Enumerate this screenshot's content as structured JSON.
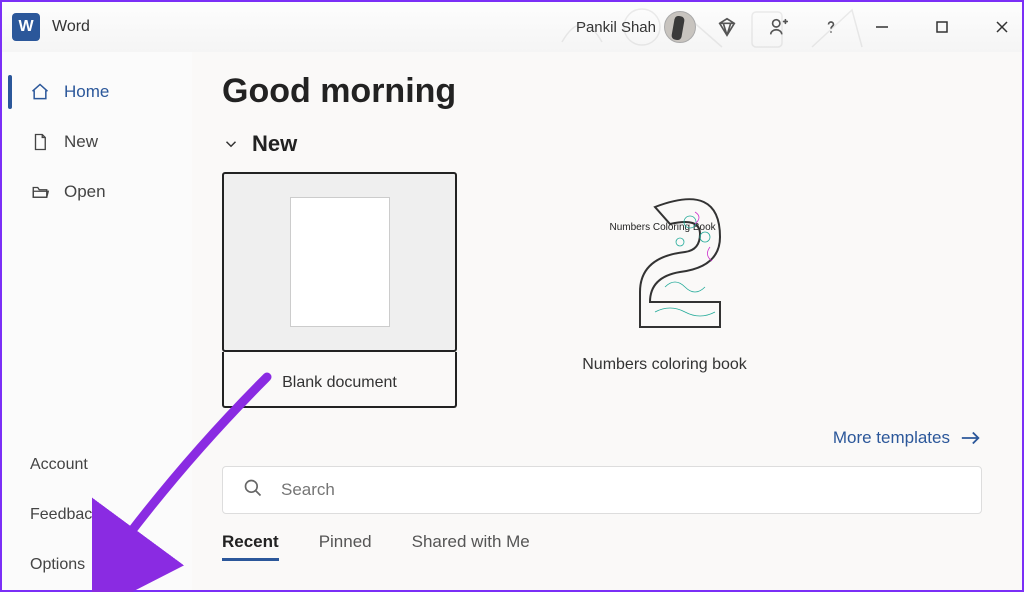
{
  "app": {
    "name": "Word",
    "logo_letter": "W"
  },
  "user": {
    "name": "Pankil Shah"
  },
  "sidebar": {
    "top": [
      {
        "label": "Home",
        "icon": "home"
      },
      {
        "label": "New",
        "icon": "file"
      },
      {
        "label": "Open",
        "icon": "folder"
      }
    ],
    "bottom": [
      {
        "label": "Account"
      },
      {
        "label": "Feedback"
      },
      {
        "label": "Options"
      }
    ]
  },
  "main": {
    "greeting": "Good morning",
    "section_title": "New",
    "templates": [
      {
        "label": "Blank document"
      },
      {
        "label": "Numbers coloring book"
      }
    ],
    "thumb_text": "Numbers Coloring Book",
    "more_link": "More templates",
    "search_placeholder": "Search",
    "tabs": [
      {
        "label": "Recent",
        "active": true
      },
      {
        "label": "Pinned",
        "active": false
      },
      {
        "label": "Shared with Me",
        "active": false
      }
    ]
  },
  "annotation": {
    "points_to": "Options"
  }
}
